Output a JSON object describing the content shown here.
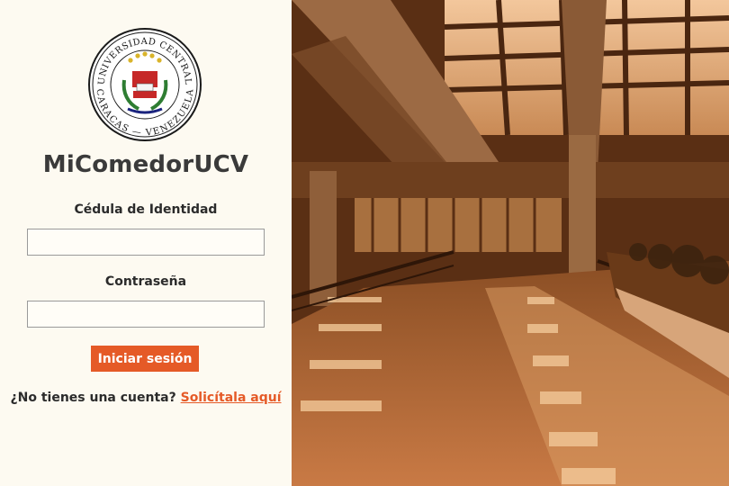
{
  "app": {
    "title": "MiComedorUCV"
  },
  "seal": {
    "top_text": "UNIVERSIDAD CENTRAL",
    "bottom_text": "CARACAS — VENEZUELA"
  },
  "form": {
    "id_label": "Cédula de Identidad",
    "id_value": "",
    "password_label": "Contraseña",
    "password_value": "",
    "submit_label": "Iniciar sesión"
  },
  "signup": {
    "prompt": "¿No tienes una cuenta?",
    "link_label": "Solicítala aquí"
  },
  "colors": {
    "accent": "#e55a27",
    "panel_bg": "#fdfaf1",
    "photo_tint": "#c97a45"
  }
}
